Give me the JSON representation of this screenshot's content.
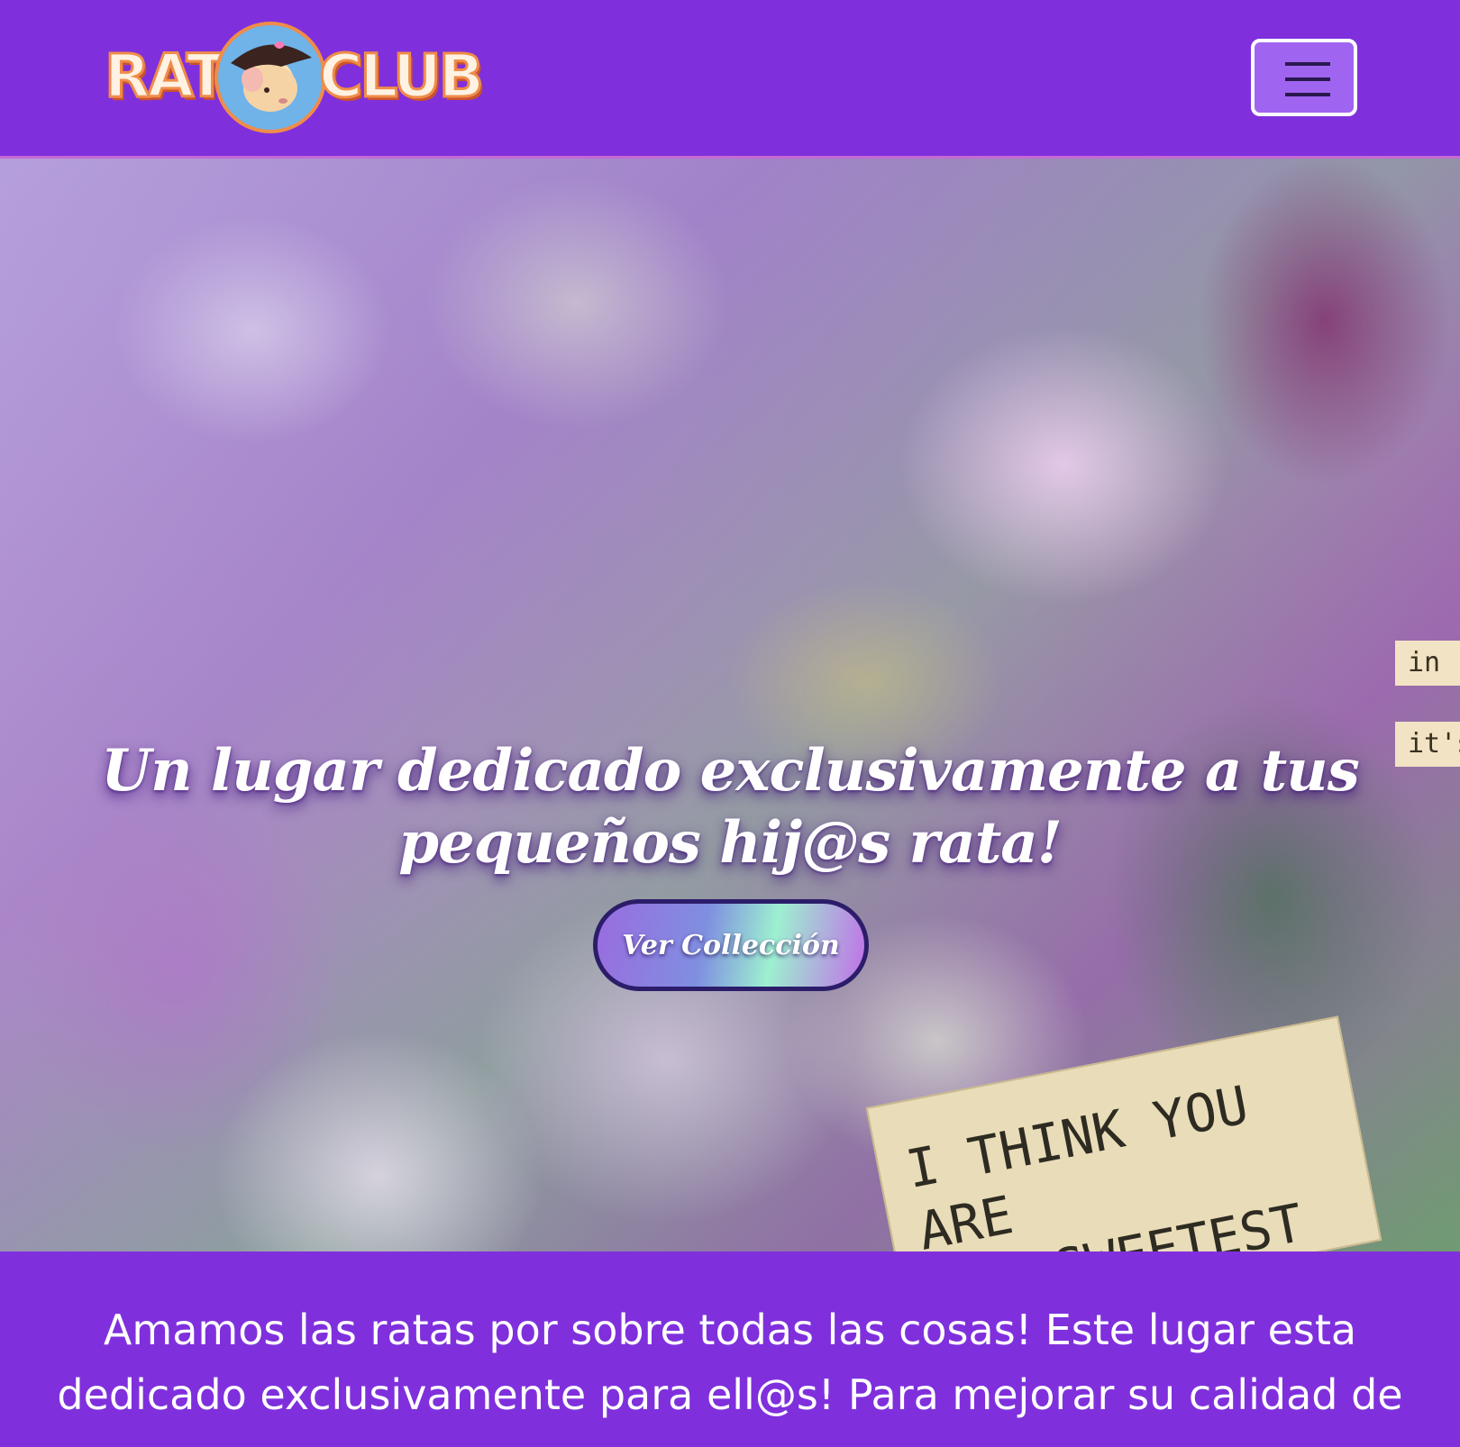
{
  "navbar": {
    "logo_left": "RAT",
    "logo_right": "CLUB",
    "toggler_icon": "hamburger-icon"
  },
  "hero": {
    "title_line1": "Un lugar dedicado exclusivamente a tus",
    "title_line2": "pequeños hij@s rata!",
    "button_label": "Ver Collección",
    "sign_line1": "I THINK YOU ARE",
    "sign_line2": "THE SWEETEST",
    "side_note_1": "in",
    "side_note_2": "it's"
  },
  "intro": {
    "text": "Amamos las ratas por sobre todas las cosas! Este lugar esta dedicado exclusivamente para ell@s! Para mejorar su calidad de"
  },
  "colors": {
    "navbar_bg": "#7f30dc",
    "accent_orange": "#f08c4a",
    "button_border": "#2c1d6a"
  }
}
